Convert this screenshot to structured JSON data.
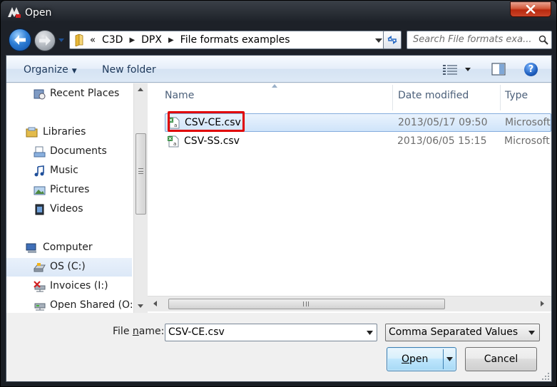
{
  "window": {
    "title": "Open"
  },
  "address": {
    "overflow": "«",
    "crumbs": [
      "C3D",
      "DPX",
      "File formats examples"
    ]
  },
  "search": {
    "placeholder": "Search File formats exa..."
  },
  "toolbar": {
    "organize_label": "Organize",
    "new_folder_label": "New folder",
    "help_label": "?"
  },
  "nav": {
    "items": [
      {
        "label": "Recent Places",
        "icon": "recent-places-icon"
      },
      {
        "label": "Libraries",
        "icon": "libraries-icon"
      },
      {
        "label": "Documents",
        "icon": "documents-icon"
      },
      {
        "label": "Music",
        "icon": "music-icon"
      },
      {
        "label": "Pictures",
        "icon": "pictures-icon"
      },
      {
        "label": "Videos",
        "icon": "videos-icon"
      },
      {
        "label": "Computer",
        "icon": "computer-icon"
      },
      {
        "label": "OS (C:)",
        "icon": "drive-icon",
        "selected": true
      },
      {
        "label": "Invoices (I:)",
        "icon": "network-drive-disconnected-icon"
      },
      {
        "label": "Open Shared (O:)",
        "icon": "network-drive-icon"
      }
    ]
  },
  "files": {
    "columns": {
      "name": "Name",
      "date": "Date modified",
      "type": "Type"
    },
    "rows": [
      {
        "name": "CSV-CE.csv",
        "date": "2013/05/17 09:50",
        "type": "Microsoft",
        "selected": true
      },
      {
        "name": "CSV-SS.csv",
        "date": "2013/06/05 15:15",
        "type": "Microsoft"
      }
    ]
  },
  "footer": {
    "filename_label_pre": "File ",
    "filename_label_key": "n",
    "filename_label_post": "ame:",
    "filename_value": "CSV-CE.csv",
    "filter_value": "Comma Separated Values (*.csv)",
    "open_label_key": "O",
    "open_label_rest": "pen",
    "cancel_label": "Cancel"
  },
  "colors": {
    "selection_fill": "#cfe4fa",
    "highlight_outline": "#e00000",
    "title_text": "#ffffff",
    "toolbar_text": "#1e395b"
  }
}
